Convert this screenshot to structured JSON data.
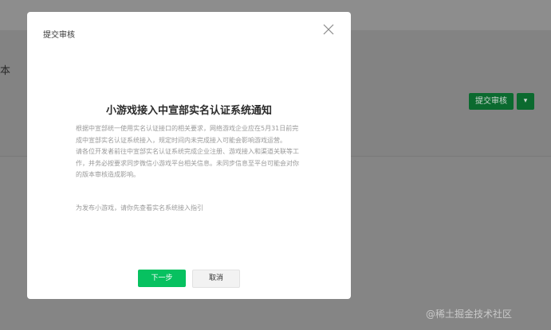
{
  "background": {
    "page_title": "本",
    "submit_button": "提交审核",
    "dropdown_icon": "chevron-down-icon"
  },
  "modal": {
    "title": "提交审核",
    "close_icon": "close-icon",
    "notice_title": "小游戏接入中宣部实名认证系统通知",
    "paragraph1": "根据中宣部统一使用实名认证接口的相关要求，网络游戏企业应在5月31日前完成中宣部实名认证系统接入，规定时间内未完成接入可能会影响游戏运营。",
    "paragraph2": "请各位开发者前往中宣部实名认证系统完成企业注册、游戏接入和渠道关联等工作，并务必按要求同步微信小游戏平台相关信息。未同步信息至平台可能会对你的版本审核造成影响。",
    "guide_text": "为发布小游戏，请你先查看实名系统接入指引",
    "next_button": "下一步",
    "cancel_button": "取消"
  },
  "watermark": "@稀土掘金技术社区"
}
